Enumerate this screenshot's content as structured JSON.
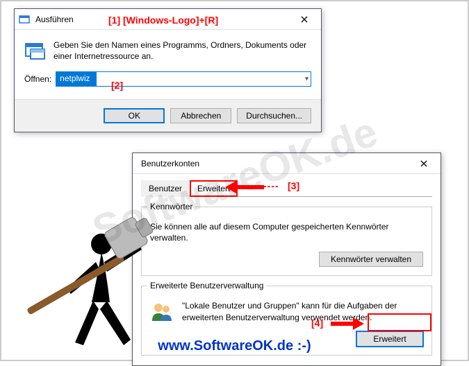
{
  "run": {
    "title": "Ausführen",
    "desc": "Geben Sie den Namen eines Programms, Ordners, Dokuments oder einer Internetressource an.",
    "open_label": "Öffnen:",
    "input_value": "netplwiz",
    "ok": "OK",
    "cancel": "Abbrechen",
    "browse": "Durchsuchen..."
  },
  "ua": {
    "title": "Benutzerkonten",
    "tab_users": "Benutzer",
    "tab_advanced": "Erweitert",
    "pw_legend": "Kennwörter",
    "pw_desc": "Sie können alle auf diesem Computer gespeicherten Kennwörter verwalten.",
    "pw_btn": "Kennwörter verwalten",
    "adv_legend": "Erweiterte Benutzerverwaltung",
    "adv_desc": "\"Lokale Benutzer und Gruppen\" kann für die Aufgaben der erweiterten Benutzerverwaltung verwendet werden.",
    "adv_btn": "Erweitert"
  },
  "anno": {
    "a1": "[1]  [Windows-Logo]+[R]",
    "a2": "[2]",
    "a3_dash": "----",
    "a3": "[3]",
    "a4": "[4]"
  },
  "site": {
    "watermark": "SoftwareOK.de",
    "footer": "www.SoftwareOK.de :-)"
  }
}
